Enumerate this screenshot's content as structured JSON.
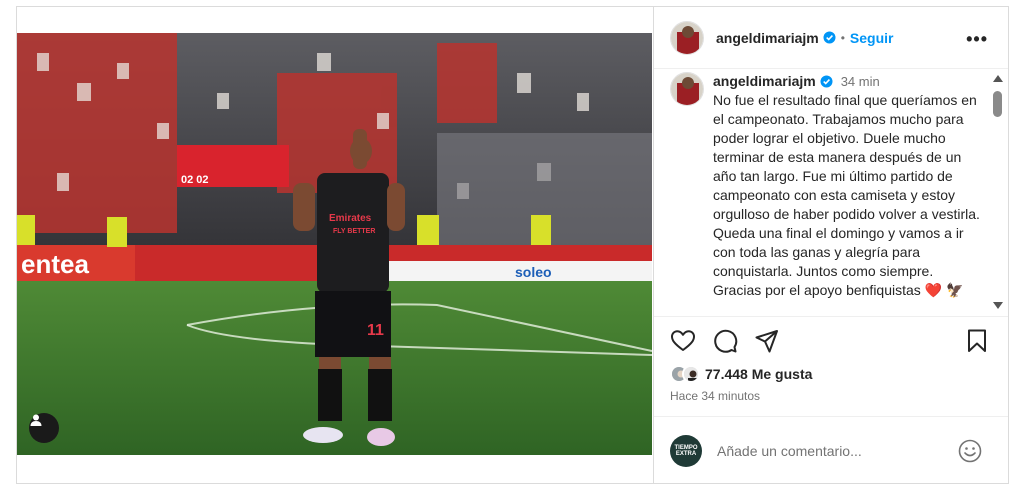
{
  "post": {
    "username": "angeldimariajm",
    "follow_label": "Seguir",
    "separator": "•",
    "more_label": "•••",
    "caption": {
      "username": "angeldimariajm",
      "time": "34 min",
      "text": "No fue el resultado final que queríamos en el campeonato. Trabajamos mucho para poder lograr el objetivo. Duele mucho terminar de esta manera después de un año tan largo. Fue mi último partido de campeonato con esta camiseta y estoy orgulloso de haber podido volver a vestirla. Queda una final el domingo y vamos a ir con toda las ganas y alegría para conquistarla. Juntos como siempre. Gracias por el apoyo benfiquistas ❤️ 🦅"
    },
    "likes": "77.448 Me gusta",
    "ago": "Hace 34 minutos"
  },
  "media": {
    "shirt_sponsor": "Emirates",
    "shirt_sponsor2": "FLY BETTER",
    "shirt_number": "11",
    "scoreboard": "02  02",
    "ad_left": "entea",
    "ad_right": "soleo"
  },
  "comment": {
    "placeholder": "Añade un comentario...",
    "avatar_text": "TIEMPO EXTRA"
  },
  "icons": {
    "verified": "verified-badge-icon",
    "like": "heart-icon",
    "comment": "comment-icon",
    "share": "share-icon",
    "save": "bookmark-icon",
    "emoji": "emoji-icon",
    "tag": "user-tag-icon"
  },
  "colors": {
    "accent": "#0095f6",
    "text": "#262626",
    "muted": "#737373",
    "border": "#dbdbdb"
  }
}
